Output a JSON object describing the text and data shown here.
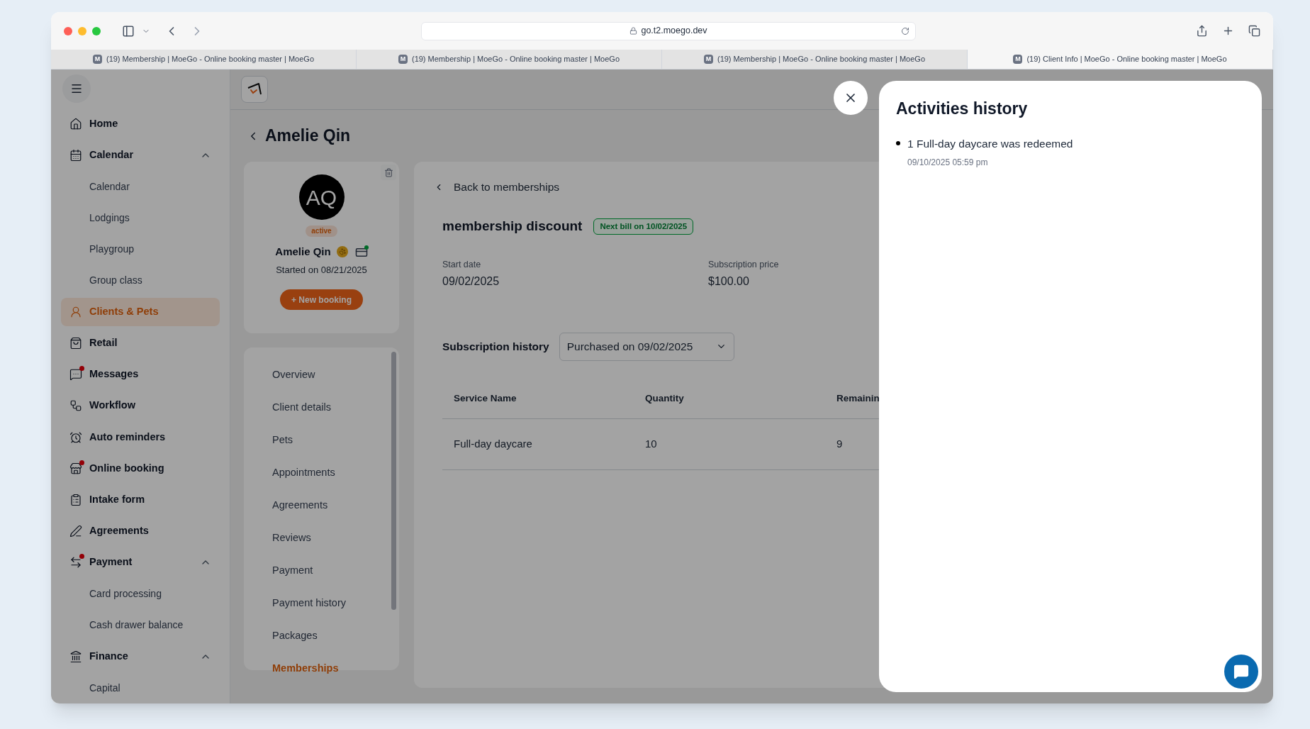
{
  "browser": {
    "url": "go.t2.moego.dev",
    "tabs": [
      {
        "favicon": "M",
        "title": "(19) Membership | MoeGo - Online booking master | MoeGo",
        "selected": false
      },
      {
        "favicon": "M",
        "title": "(19) Membership | MoeGo - Online booking master | MoeGo",
        "selected": false
      },
      {
        "favicon": "M",
        "title": "(19) Membership | MoeGo - Online booking master | MoeGo",
        "selected": false
      },
      {
        "favicon": "M",
        "title": "(19) Client Info | MoeGo - Online booking master | MoeGo",
        "selected": true
      }
    ]
  },
  "sidebar": {
    "items": [
      {
        "label": "Home",
        "selected": false,
        "dot": false
      },
      {
        "label": "Calendar",
        "selected": false,
        "dot": false,
        "expanded": true,
        "children": [
          {
            "label": "Calendar",
            "selected": false
          },
          {
            "label": "Lodgings",
            "selected": false
          },
          {
            "label": "Playgroup",
            "selected": false
          },
          {
            "label": "Group class",
            "selected": false
          }
        ]
      },
      {
        "label": "Clients & Pets",
        "selected": true,
        "dot": false
      },
      {
        "label": "Retail",
        "selected": false,
        "dot": false
      },
      {
        "label": "Messages",
        "selected": false,
        "dot": true
      },
      {
        "label": "Workflow",
        "selected": false,
        "dot": false
      },
      {
        "label": "Auto reminders",
        "selected": false,
        "dot": false
      },
      {
        "label": "Online booking",
        "selected": false,
        "dot": true
      },
      {
        "label": "Intake form",
        "selected": false,
        "dot": false
      },
      {
        "label": "Agreements",
        "selected": false,
        "dot": false
      },
      {
        "label": "Payment",
        "selected": false,
        "dot": true,
        "expanded": true,
        "children": [
          {
            "label": "Card processing",
            "selected": false
          },
          {
            "label": "Cash drawer balance",
            "selected": false
          }
        ]
      },
      {
        "label": "Finance",
        "selected": false,
        "dot": false,
        "expanded": true,
        "children": [
          {
            "label": "Capital",
            "selected": false
          }
        ]
      }
    ]
  },
  "page": {
    "title": "Amelie Qin"
  },
  "client_card": {
    "initials": "AQ",
    "status": "active",
    "name": "Amelie Qin",
    "started": "Started on 08/21/2025",
    "new_booking": "+ New booking"
  },
  "client_nav": [
    {
      "label": "Overview",
      "selected": false
    },
    {
      "label": "Client details",
      "selected": false
    },
    {
      "label": "Pets",
      "selected": false
    },
    {
      "label": "Appointments",
      "selected": false
    },
    {
      "label": "Agreements",
      "selected": false
    },
    {
      "label": "Reviews",
      "selected": false
    },
    {
      "label": "Payment",
      "selected": false
    },
    {
      "label": "Payment history",
      "selected": false
    },
    {
      "label": "Packages",
      "selected": false
    },
    {
      "label": "Memberships",
      "selected": true
    }
  ],
  "membership": {
    "back": "Back to memberships",
    "name": "membership discount",
    "badge": "Next bill on 10/02/2025",
    "fields": [
      {
        "label": "Start date",
        "value": "09/02/2025"
      },
      {
        "label": "Subscription price",
        "value": "$100.00"
      }
    ],
    "history_label": "Subscription history",
    "history_select": "Purchased on 09/02/2025",
    "table": {
      "columns": [
        "Service Name",
        "Quantity",
        "Remainin"
      ],
      "rows": [
        [
          "Full-day daycare",
          "10",
          "9"
        ]
      ]
    }
  },
  "drawer": {
    "title": "Activities history",
    "activities": [
      {
        "text": "1 Full-day daycare was redeemed",
        "time": "09/10/2025 05:59 pm"
      }
    ]
  }
}
